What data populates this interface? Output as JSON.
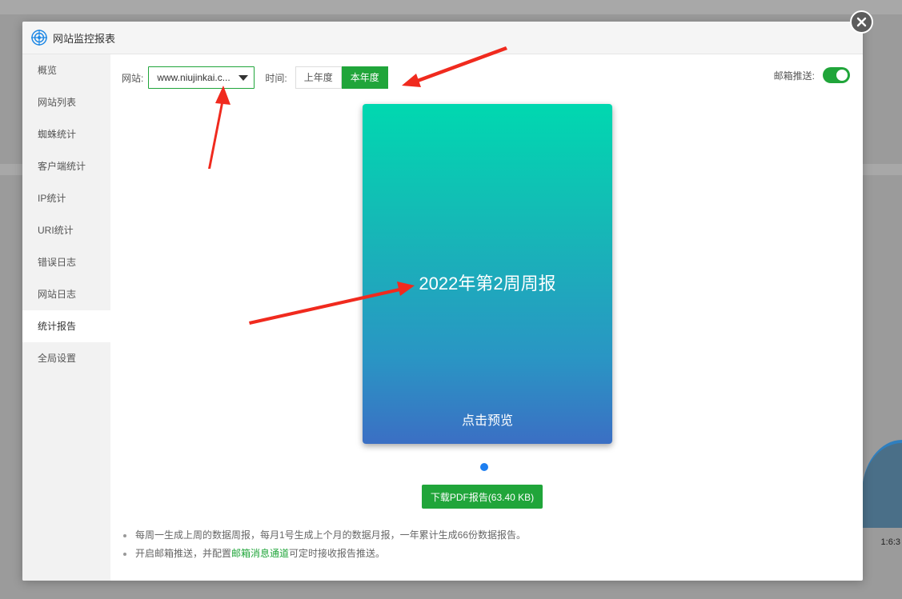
{
  "dialog": {
    "title": "网站监控报表"
  },
  "sidebar": {
    "items": [
      {
        "label": "概览"
      },
      {
        "label": "网站列表"
      },
      {
        "label": "蜘蛛统计"
      },
      {
        "label": "客户端统计"
      },
      {
        "label": "IP统计"
      },
      {
        "label": "URI统计"
      },
      {
        "label": "错误日志"
      },
      {
        "label": "网站日志"
      },
      {
        "label": "统计报告",
        "active": true
      },
      {
        "label": "全局设置"
      }
    ]
  },
  "toolbar": {
    "site_label": "网站:",
    "site_value": "www.niujinkai.c...",
    "time_label": "时间:",
    "time_options": [
      "上年度",
      "本年度"
    ],
    "time_selected": "本年度",
    "email_label": "邮箱推送:",
    "email_enabled": true
  },
  "report": {
    "title": "2022年第2周周报",
    "preview_label": "点击预览",
    "download_label": "下载PDF报告(63.40 KB)"
  },
  "notes": {
    "line1": "每周一生成上周的数据周报，每月1号生成上个月的数据月报，一年累计生成66份数据报告。",
    "line2_prefix": "开启邮箱推送，并配置",
    "line2_link": "邮箱消息通道",
    "line2_suffix": "可定时接收报告推送。"
  },
  "background": {
    "axis_tick": "1:6:3"
  },
  "colors": {
    "accent": "#20a53a",
    "annotation_arrow": "#f02a1e",
    "card_gradient_top": "#00d8b0",
    "card_gradient_bottom": "#3b6fc4",
    "dot": "#1e7ff0"
  }
}
